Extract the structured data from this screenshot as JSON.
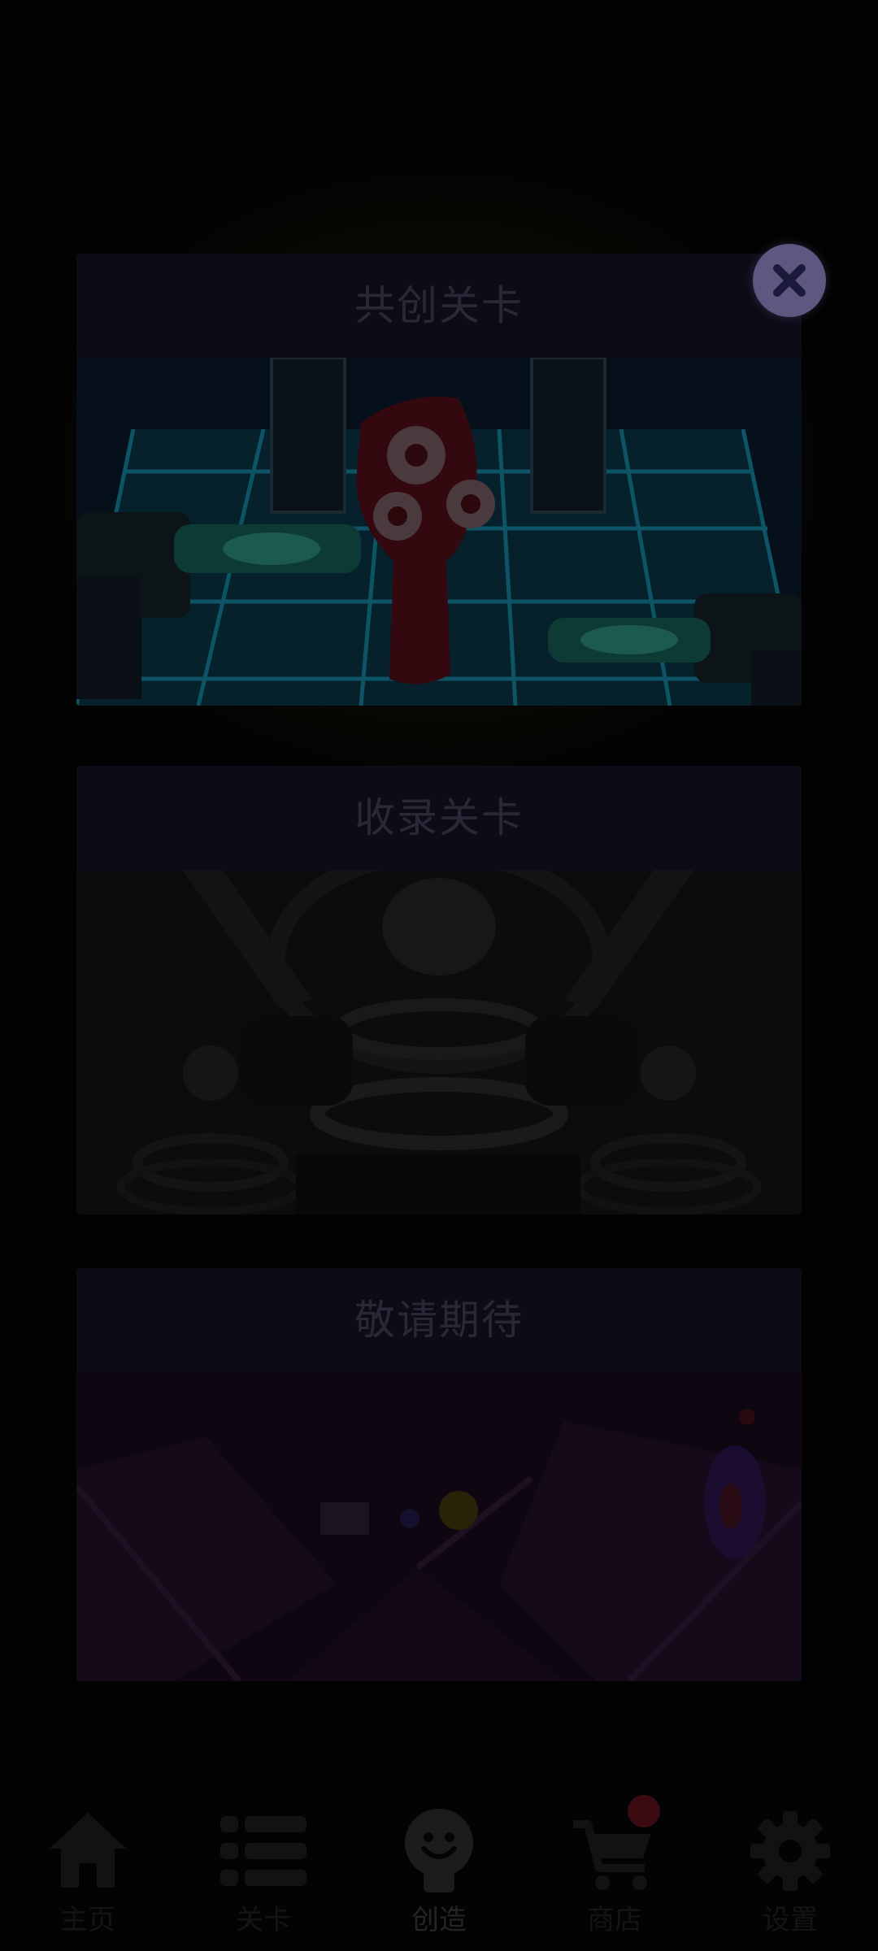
{
  "cards": [
    {
      "title": "共创关卡"
    },
    {
      "title": "收录关卡"
    },
    {
      "title": "敬请期待"
    }
  ],
  "close_button": {
    "icon": "close-icon",
    "color": "#5e5880"
  },
  "bottom_nav": {
    "items": [
      {
        "label": "主页",
        "icon": "home-icon",
        "active": false
      },
      {
        "label": "关卡",
        "icon": "list-icon",
        "active": false
      },
      {
        "label": "创造",
        "icon": "lightbulb-icon",
        "active": true
      },
      {
        "label": "商店",
        "icon": "cart-icon",
        "active": false,
        "badge": true
      },
      {
        "label": "设置",
        "icon": "gear-icon",
        "active": false
      }
    ]
  },
  "colors": {
    "background": "#020202",
    "card_title_bg": "#0d0b16",
    "card_title_text": "#2a2836",
    "badge": "#3a0b10"
  }
}
